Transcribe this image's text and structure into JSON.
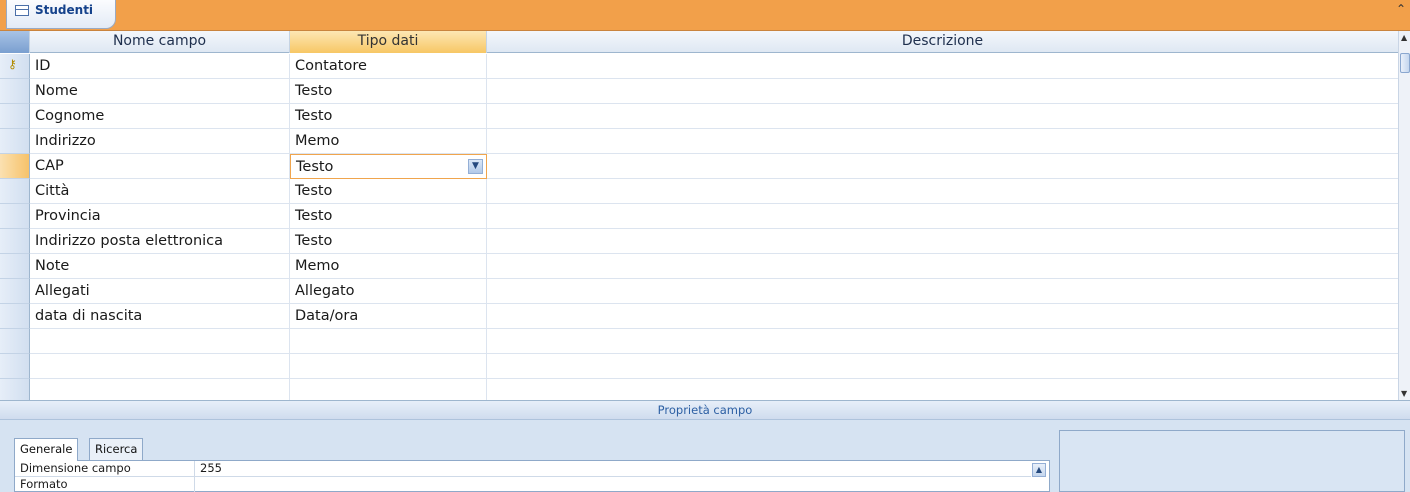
{
  "document_tab": {
    "title": "Studenti"
  },
  "grid": {
    "headers": {
      "name": "Nome campo",
      "type": "Tipo dati",
      "description": "Descrizione"
    },
    "rows": [
      {
        "name": "ID",
        "type": "Contatore",
        "description": ""
      },
      {
        "name": "Nome",
        "type": "Testo",
        "description": ""
      },
      {
        "name": "Cognome",
        "type": "Testo",
        "description": ""
      },
      {
        "name": "Indirizzo",
        "type": "Memo",
        "description": ""
      },
      {
        "name": "CAP",
        "type": "Testo",
        "description": ""
      },
      {
        "name": "Città",
        "type": "Testo",
        "description": ""
      },
      {
        "name": "Provincia",
        "type": "Testo",
        "description": ""
      },
      {
        "name": "Indirizzo posta elettronica",
        "type": "Testo",
        "description": ""
      },
      {
        "name": "Note",
        "type": "Memo",
        "description": ""
      },
      {
        "name": "Allegati",
        "type": "Allegato",
        "description": ""
      },
      {
        "name": "data di nascita",
        "type": "Data/ora",
        "description": ""
      },
      {
        "name": "",
        "type": "",
        "description": ""
      },
      {
        "name": "",
        "type": "",
        "description": ""
      },
      {
        "name": "",
        "type": "",
        "description": ""
      }
    ],
    "current_row_index": 4,
    "primary_key_row_index": 0
  },
  "properties": {
    "title": "Proprietà campo",
    "tabs": [
      "Generale",
      "Ricerca"
    ],
    "active_tab": "Generale",
    "items": [
      {
        "label": "Dimensione campo",
        "value": "255"
      },
      {
        "label": "Formato",
        "value": ""
      }
    ]
  },
  "icons": {
    "primary_key": "key-icon",
    "dropdown": "chevron-down-icon",
    "table": "table-icon"
  }
}
